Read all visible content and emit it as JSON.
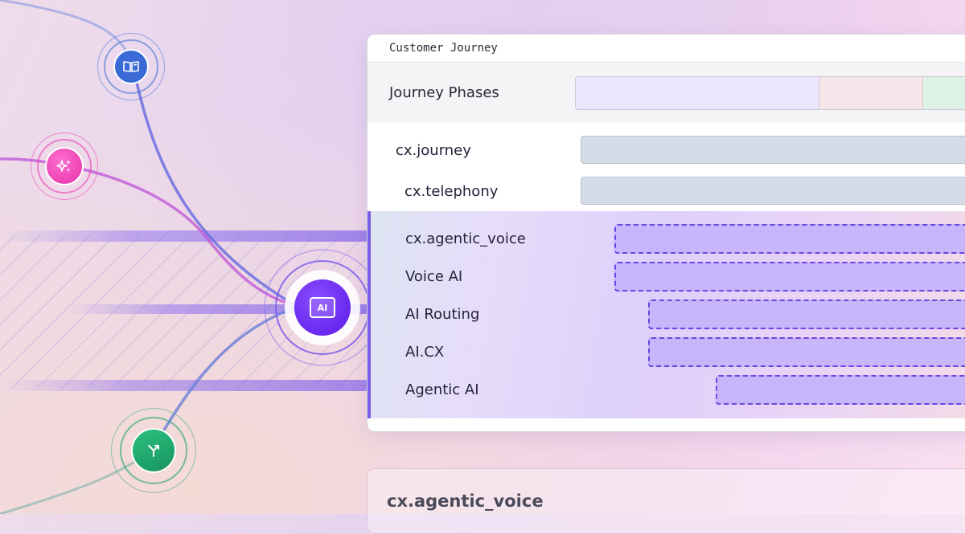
{
  "card": {
    "title": "Customer Journey"
  },
  "phases": {
    "label": "Journey Phases",
    "colors": [
      "#ebe5fd",
      "#f6e5e8",
      "#dcf2e4"
    ]
  },
  "rows": [
    {
      "label": "cx.journey"
    },
    {
      "label": "cx.telephony"
    }
  ],
  "agentic_rows": [
    {
      "label": "cx.agentic_voice"
    },
    {
      "label": "Voice AI"
    },
    {
      "label": "AI Routing"
    },
    {
      "label": "AI.CX"
    },
    {
      "label": "Agentic AI"
    }
  ],
  "nodes": {
    "center": {
      "label": "AI",
      "color": "#6d2ff0"
    },
    "book": {
      "icon": "book-open-icon",
      "color": "#3a6ad6"
    },
    "sparkle": {
      "icon": "sparkles-icon",
      "color": "#ee3fb8"
    },
    "merge": {
      "icon": "merge-arrow-icon",
      "color": "#1fa46c"
    }
  },
  "bottom_card": {
    "title": "cx.agentic_voice"
  }
}
